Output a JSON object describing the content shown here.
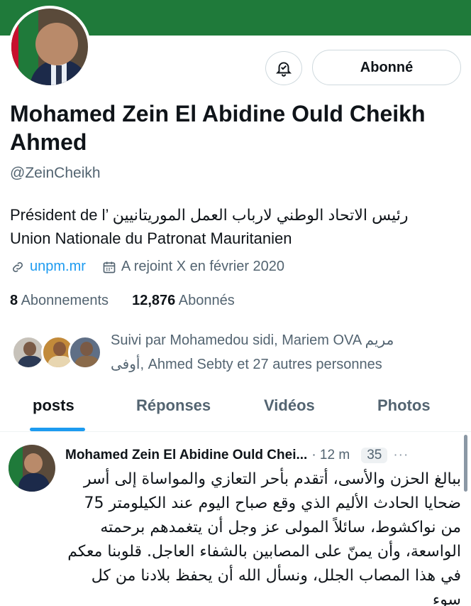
{
  "profile": {
    "name": "Mohamed Zein El Abidine Ould Cheikh Ahmed",
    "handle": "@ZeinCheikh",
    "follow_button_label": "Abonné",
    "bell_icon": "bell-notify-icon",
    "bio_line1_fr": "Président de l’",
    "bio_line1_ar": "رئيس الاتحاد الوطني لارباب العمل الموريتانيين",
    "bio_line2": "Union Nationale du Patronat Mauritanien",
    "link_icon": "link-icon",
    "website": "unpm.mr",
    "calendar_icon": "calendar-icon",
    "joined": "A rejoint X en février 2020",
    "following_count": "8",
    "following_label": "Abonnements",
    "followers_count": "12,876",
    "followers_label": "Abonnés",
    "followed_by_line1": "Suivi par Mohamedou sidi, Mariem OVA مريم",
    "followed_by_line2": "أوفى, Ahmed Sebty et 27 autres personnes"
  },
  "tabs": [
    {
      "label": "posts",
      "active": true
    },
    {
      "label": "Réponses",
      "active": false
    },
    {
      "label": "Vidéos",
      "active": false
    },
    {
      "label": "Photos",
      "active": false
    }
  ],
  "post": {
    "author": "Mohamed Zein El Abidine Ould Chei...",
    "time": "· 12 m",
    "count": "35",
    "more": "···",
    "body": "ببالغ الحزن والأسى، أتقدم بأحر التعازي والمواساة إلى أسر ضحايا الحادث الأليم الذي وقع صباح اليوم عند الكيلومتر 75 من نواكشوط، سائلاً المولى عز وجل أن يتغمدهم برحمته الواسعة، وأن يمنّ على المصابين بالشفاء العاجل. قلوبنا معكم في هذا المصاب الجلل، ونسأل الله أن يحفظ بلادنا من كل سوء"
  },
  "colors": {
    "banner": "#1f7a3a",
    "accent": "#1d9bf0",
    "secondary_text": "#536471"
  }
}
